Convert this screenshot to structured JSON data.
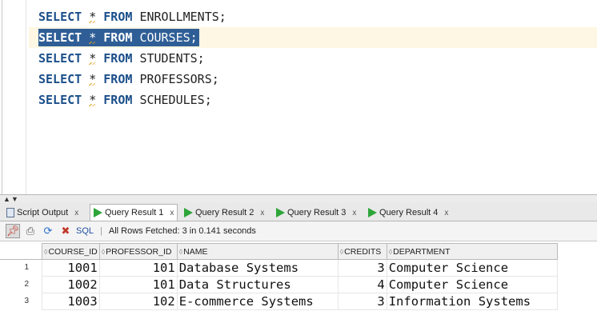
{
  "editor": {
    "lines": [
      {
        "kw1": "SELECT",
        "star": "*",
        "kw2": "FROM",
        "table": "ENROLLMENTS;"
      },
      {
        "kw1": "SELECT",
        "star": "*",
        "kw2": "FROM",
        "table": "COURSES;"
      },
      {
        "kw1": "SELECT",
        "star": "*",
        "kw2": "FROM",
        "table": "STUDENTS;"
      },
      {
        "kw1": "SELECT",
        "star": "*",
        "kw2": "FROM",
        "table": "PROFESSORS;"
      },
      {
        "kw1": "SELECT",
        "star": "*",
        "kw2": "FROM",
        "table": "SCHEDULES;"
      }
    ]
  },
  "tabs": [
    {
      "label": "Script Output",
      "close": "x",
      "icon": "script-output-icon"
    },
    {
      "label": "Query Result 1",
      "close": "x",
      "icon": "run-icon",
      "active": true
    },
    {
      "label": "Query Result 2",
      "close": "x",
      "icon": "run-icon"
    },
    {
      "label": "Query Result 3",
      "close": "x",
      "icon": "run-icon"
    },
    {
      "label": "Query Result 4",
      "close": "x",
      "icon": "run-icon"
    }
  ],
  "toolbar": {
    "sql_label": "SQL",
    "separator": "|",
    "status": "All Rows Fetched: 3 in 0.141 seconds"
  },
  "grid": {
    "columns": [
      "COURSE_ID",
      "PROFESSOR_ID",
      "NAME",
      "CREDITS",
      "DEPARTMENT"
    ],
    "rows": [
      {
        "n": "1",
        "course_id": "1001",
        "professor_id": "101",
        "name": "Database Systems",
        "credits": "3",
        "department": "Computer Science"
      },
      {
        "n": "2",
        "course_id": "1002",
        "professor_id": "101",
        "name": "Data Structures",
        "credits": "4",
        "department": "Computer Science"
      },
      {
        "n": "3",
        "course_id": "1003",
        "professor_id": "102",
        "name": "E-commerce Systems",
        "credits": "3",
        "department": "Information Systems"
      }
    ]
  },
  "colors": {
    "keyword": "#1b4f8a",
    "selection": "#2f5e96",
    "current_line": "#fdf7e3",
    "run_green": "#2ea53a"
  }
}
